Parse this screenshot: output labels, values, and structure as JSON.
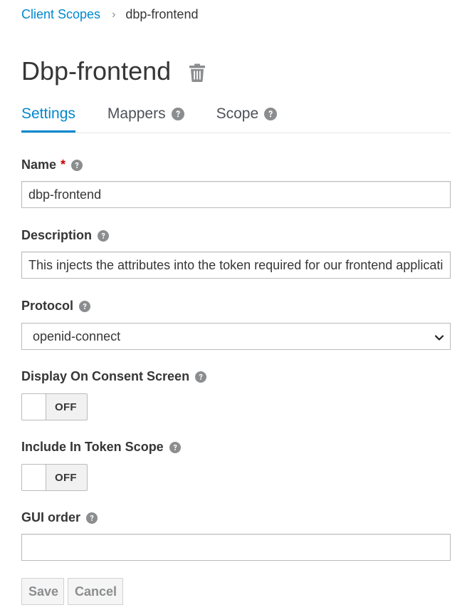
{
  "breadcrumb": {
    "parent": "Client Scopes",
    "separator": "›",
    "current": "dbp-frontend"
  },
  "header": {
    "title": "Dbp-frontend",
    "delete_icon": "trash-icon"
  },
  "tabs": [
    {
      "label": "Settings",
      "active": true
    },
    {
      "label": "Mappers",
      "icon": "question-circle-icon"
    },
    {
      "label": "Scope",
      "icon": "question-circle-icon"
    }
  ],
  "form": {
    "name": {
      "label": "Name",
      "required_marker": "*",
      "value": "dbp-frontend"
    },
    "description": {
      "label": "Description",
      "value": "This injects the attributes into the token required for our frontend applications"
    },
    "protocol": {
      "label": "Protocol",
      "selected": "openid-connect"
    },
    "display_on_consent": {
      "label": "Display On Consent Screen",
      "state": "OFF"
    },
    "include_in_token_scope": {
      "label": "Include In Token Scope",
      "state": "OFF"
    },
    "gui_order": {
      "label": "GUI order",
      "value": ""
    }
  },
  "actions": {
    "save_label": "Save",
    "cancel_label": "Cancel"
  },
  "colors": {
    "link": "#0088ce",
    "text": "#363636",
    "required": "#cc0000",
    "icon_gray": "#8b8d8f"
  }
}
